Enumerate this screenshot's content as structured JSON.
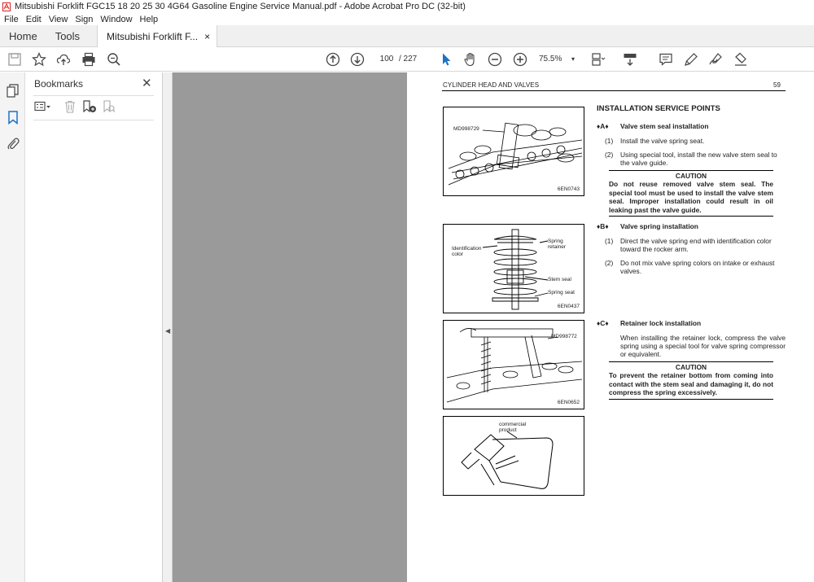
{
  "window": {
    "title": "Mitsubishi Forklift FGC15 18 20 25 30 4G64 Gasoline Engine Service Manual.pdf - Adobe Acrobat Pro DC (32-bit)"
  },
  "menu": [
    "File",
    "Edit",
    "View",
    "Sign",
    "Window",
    "Help"
  ],
  "tabs": {
    "home": "Home",
    "tools": "Tools",
    "document": "Mitsubishi Forklift F...",
    "close": "×"
  },
  "toolbar": {
    "page_current": "100",
    "page_total": "/  227",
    "zoom": "75.5%"
  },
  "bookmarks": {
    "title": "Bookmarks",
    "close": "✕"
  },
  "page": {
    "header": "CYLINDER HEAD AND VALVES",
    "number": "59",
    "section_title": "INSTALLATION SERVICE POINTS",
    "a": {
      "marker": "♦A♦",
      "title": "Valve stem seal installation",
      "steps": [
        {
          "n": "(1)",
          "text": "Install the valve spring seat."
        },
        {
          "n": "(2)",
          "text": "Using special tool, install the new valve stem seal to the valve guide."
        }
      ],
      "caution_head": "CAUTION",
      "caution_text": "Do not reuse removed valve stem seal. The special tool must be used to install the valve stem seal. Improper installation could result in oil leaking past the valve guide."
    },
    "b": {
      "marker": "♦B♦",
      "title": "Valve spring installation",
      "steps": [
        {
          "n": "(1)",
          "text": "Direct the valve spring end with identification color toward the rocker arm."
        },
        {
          "n": "(2)",
          "text": "Do not mix valve spring colors on intake or exhaust valves."
        }
      ]
    },
    "c": {
      "marker": "♦C♦",
      "title": "Retainer lock installation",
      "body": "When installing the retainer lock, compress the valve spring using a special tool for valve spring compressor or equivalent.",
      "caution_head": "CAUTION",
      "caution_text": "To prevent the retainer bottom from coming into contact with the stem seal and damaging it, do not compress the spring excessively."
    },
    "fig1": {
      "tool": "MD998729",
      "code": "6EN0743"
    },
    "fig2": {
      "ident": "Identification color",
      "retainer": "Spring retainer",
      "stem": "Stem seal",
      "seat": "Spring seat",
      "code": "6EN0437"
    },
    "fig3": {
      "tool": "MD998772",
      "code": "6EN0652"
    },
    "fig4": {
      "product": "commercial product"
    }
  }
}
